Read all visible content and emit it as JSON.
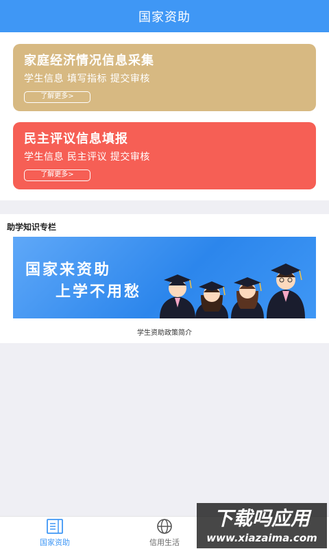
{
  "header": {
    "title": "国家资助"
  },
  "cards": [
    {
      "title": "家庭经济情况信息采集",
      "subtitle": "学生信息  填写指标  提交审核",
      "more_label": "了解更多>",
      "color": "#d7b982"
    },
    {
      "title": "民主评议信息填报",
      "subtitle": "学生信息  民主评议  提交审核",
      "more_label": "了解更多>",
      "color": "#f65f55"
    }
  ],
  "knowledge": {
    "section_title": "助学知识专栏",
    "banner_line1": "国家来资助",
    "banner_line2": "上学不用愁",
    "caption": "学生资助政策简介"
  },
  "tabbar": {
    "tabs": [
      {
        "label": "国家资助",
        "icon": "book-icon",
        "active": true
      },
      {
        "label": "信用生活",
        "icon": "globe-icon",
        "active": false
      }
    ]
  },
  "watermark": {
    "text": "下载吗应用",
    "url_text": "www.xiazaima.com"
  },
  "colors": {
    "accent": "#3f97f5",
    "card1": "#d7b982",
    "card2": "#f65f55",
    "background": "#efeff4"
  }
}
